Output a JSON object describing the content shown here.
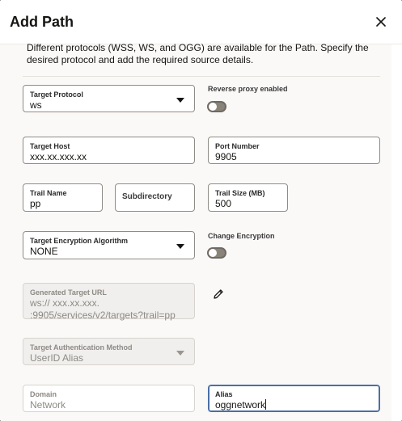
{
  "dialog": {
    "title": "Add Path",
    "description": "Different protocols (WSS, WS, and OGG) are available for the Path. Specify the desired protocol and add the required source details."
  },
  "fields": {
    "target_protocol": {
      "label": "Target Protocol",
      "value": "ws"
    },
    "reverse_proxy": {
      "label": "Reverse proxy enabled",
      "enabled": false
    },
    "target_host": {
      "label": "Target Host",
      "value": "xxx.xx.xxx.xx"
    },
    "port_number": {
      "label": "Port Number",
      "value": "9905"
    },
    "trail_name": {
      "label": "Trail Name",
      "value": "pp"
    },
    "subdirectory": {
      "placeholder": "Subdirectory"
    },
    "trail_size": {
      "label": "Trail Size (MB)",
      "value": "500"
    },
    "encryption_algorithm": {
      "label": "Target Encryption Algorithm",
      "value": "NONE"
    },
    "change_encryption": {
      "label": "Change Encryption",
      "enabled": false
    },
    "generated_url": {
      "label": "Generated Target URL",
      "value": "ws:// xxx.xx.xxx. :9905/services/v2/targets?trail=pp"
    },
    "auth_method": {
      "label": "Target Authentication Method",
      "value": "UserID Alias"
    },
    "domain": {
      "label": "Domain",
      "value": "Network"
    },
    "alias": {
      "label": "Alias",
      "value": "oggnetwork"
    }
  },
  "colors": {
    "switch_off": "#8a8379",
    "focus_border": "#4a6fa5",
    "readonly_bg": "#f1efed"
  },
  "icons": {
    "close": "close-icon",
    "edit": "pencil-icon",
    "dropdown": "chevron-down-icon"
  }
}
